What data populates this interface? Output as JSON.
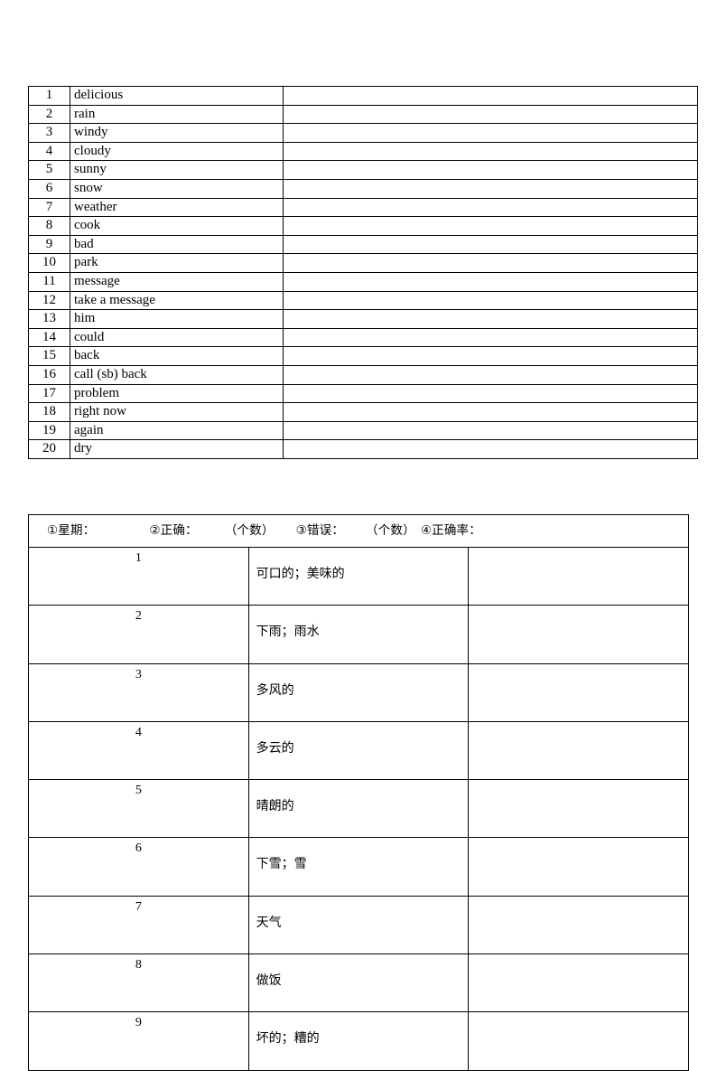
{
  "document": {
    "background_color": "#ffffff",
    "text_color": "#000000",
    "border_color": "#000000"
  },
  "vocab_table": {
    "name": "english-vocabulary-table",
    "columns": [
      "number",
      "word",
      "answer_blank"
    ],
    "rows": [
      {
        "number": "1",
        "word": "delicious",
        "answer": ""
      },
      {
        "number": "2",
        "word": "rain",
        "answer": ""
      },
      {
        "number": "3",
        "word": "windy",
        "answer": ""
      },
      {
        "number": "4",
        "word": "cloudy",
        "answer": ""
      },
      {
        "number": "5",
        "word": "sunny",
        "answer": ""
      },
      {
        "number": "6",
        "word": "snow",
        "answer": ""
      },
      {
        "number": "7",
        "word": "weather",
        "answer": ""
      },
      {
        "number": "8",
        "word": "cook",
        "answer": ""
      },
      {
        "number": "9",
        "word": "bad",
        "answer": ""
      },
      {
        "number": "10",
        "word": "park",
        "answer": ""
      },
      {
        "number": "11",
        "word": "message",
        "answer": ""
      },
      {
        "number": "12",
        "word": "take a message",
        "answer": ""
      },
      {
        "number": "13",
        "word": "him",
        "answer": ""
      },
      {
        "number": "14",
        "word": "could",
        "answer": ""
      },
      {
        "number": "15",
        "word": "back",
        "answer": ""
      },
      {
        "number": "16",
        "word": "call (sb) back",
        "answer": ""
      },
      {
        "number": "17",
        "word": "problem",
        "answer": ""
      },
      {
        "number": "18",
        "word": "right now",
        "answer": ""
      },
      {
        "number": "19",
        "word": "again",
        "answer": ""
      },
      {
        "number": "20",
        "word": "dry",
        "answer": ""
      }
    ]
  },
  "meaning_table": {
    "name": "chinese-meaning-table",
    "header": {
      "weekday_label": "①星期：",
      "correct_label": "②正确：",
      "correct_unit": "（个数）",
      "wrong_label": "③错误：",
      "wrong_unit": "（个数）",
      "accuracy_label": "④正确率："
    },
    "columns": [
      "number",
      "meaning",
      "answer_blank"
    ],
    "rows": [
      {
        "number": "1",
        "meaning": "可口的；美味的",
        "answer": ""
      },
      {
        "number": "2",
        "meaning": "下雨；雨水",
        "answer": ""
      },
      {
        "number": "3",
        "meaning": "多风的",
        "answer": ""
      },
      {
        "number": "4",
        "meaning": "多云的",
        "answer": ""
      },
      {
        "number": "5",
        "meaning": "晴朗的",
        "answer": ""
      },
      {
        "number": "6",
        "meaning": "下雪；雪",
        "answer": ""
      },
      {
        "number": "7",
        "meaning": "天气",
        "answer": ""
      },
      {
        "number": "8",
        "meaning": "做饭",
        "answer": ""
      },
      {
        "number": "9",
        "meaning": "坏的；糟的",
        "answer": ""
      }
    ]
  }
}
